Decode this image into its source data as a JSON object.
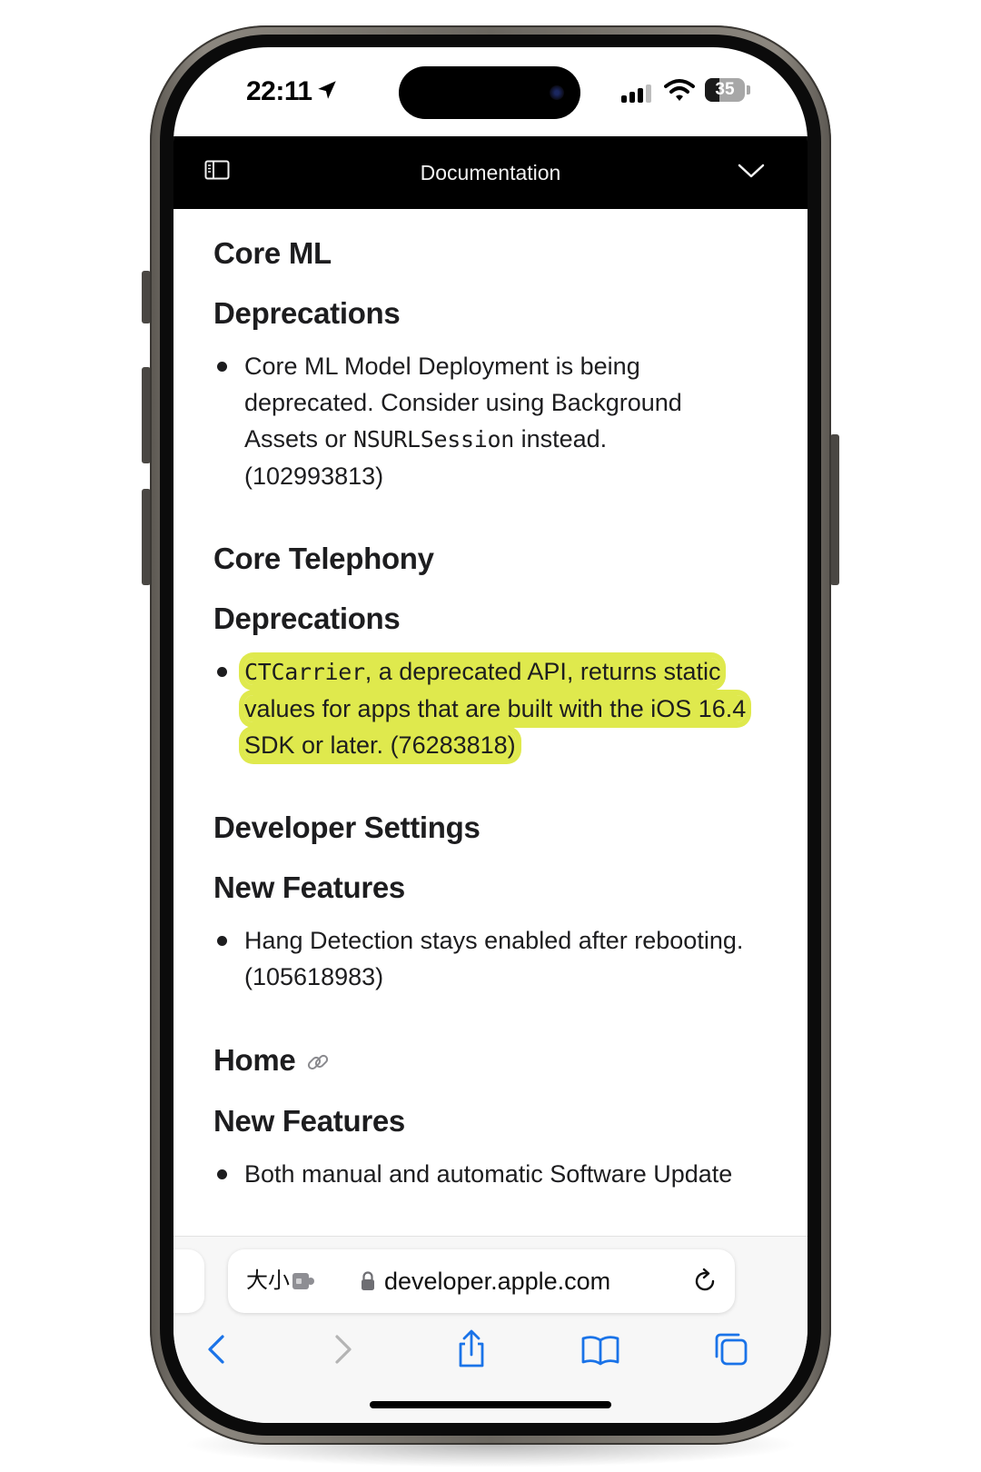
{
  "status_bar": {
    "time": "22:11",
    "battery_level": "35"
  },
  "doc_nav": {
    "title": "Documentation"
  },
  "sections": {
    "core_ml": {
      "title": "Core ML",
      "subsection": "Deprecations",
      "lines": [
        [
          "Core ML Model Deployment is being"
        ],
        [
          "deprecated. Consider using Background"
        ],
        [
          "Assets or ",
          "NSURLSession",
          " instead."
        ],
        [
          "(102993813)"
        ]
      ]
    },
    "core_telephony": {
      "title": "Core Telephony",
      "subsection": "Deprecations",
      "code": "CTCarrier",
      "line1_rest": ", a deprecated API, returns static",
      "line2": "values for apps that are built with the iOS 16.4",
      "line3": "SDK or later. (76283818)"
    },
    "developer_settings": {
      "title": "Developer Settings",
      "subsection": "New Features",
      "line1": "Hang Detection stays enabled after rebooting.",
      "line2": "(105618983)"
    },
    "home": {
      "title": "Home",
      "subsection": "New Features",
      "line1": "Both manual and automatic Software Update"
    }
  },
  "address_bar": {
    "text_size_label": "大小",
    "url": "developer.apple.com"
  },
  "colors": {
    "highlight": "#dfe94d",
    "accent": "#1a73e8",
    "disabled": "#b4b4b4"
  },
  "icons": [
    "location-arrow-icon",
    "cellular-signal-icon",
    "wifi-icon",
    "battery-icon",
    "sidebar-toggle-icon",
    "chevron-down-icon",
    "link-icon",
    "extension-icon",
    "lock-icon",
    "reload-icon",
    "back-icon",
    "forward-icon",
    "share-icon",
    "bookmarks-icon",
    "tabs-icon"
  ]
}
